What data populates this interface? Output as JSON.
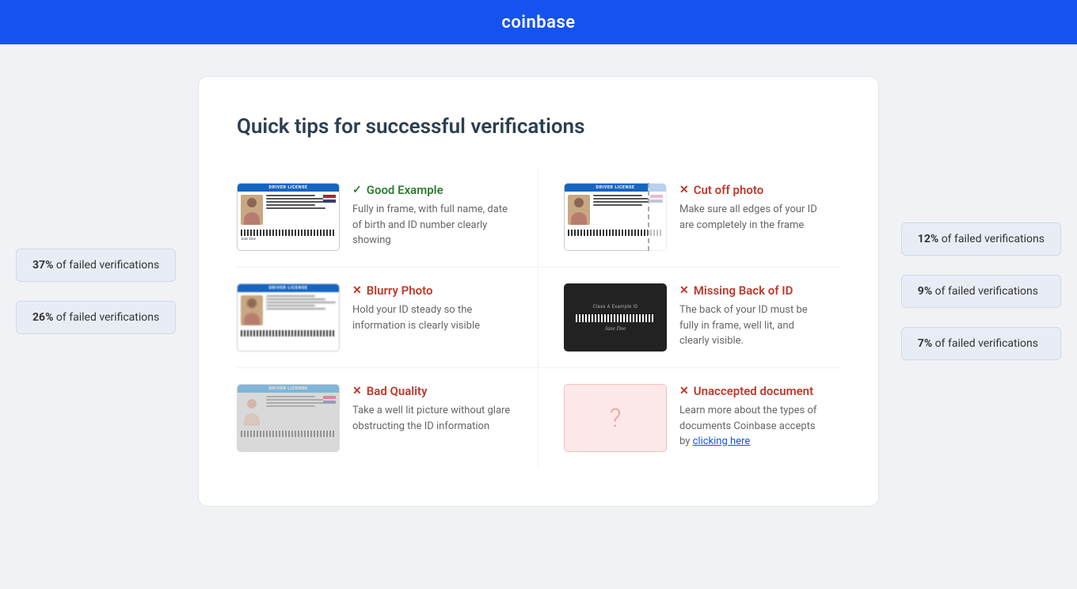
{
  "header": {
    "logo": "coinbase"
  },
  "page": {
    "title": "Quick tips for successful verifications"
  },
  "left_badges": [
    {
      "percent": "37%",
      "label": "of failed verifications"
    },
    {
      "percent": "26%",
      "label": "of failed verifications"
    }
  ],
  "right_badges": [
    {
      "percent": "12%",
      "label": "of failed verifications"
    },
    {
      "percent": "9%",
      "label": "of failed verifications"
    },
    {
      "percent": "7%",
      "label": "of failed verifications"
    }
  ],
  "tips": [
    {
      "id": "good-example",
      "status": "good",
      "icon": "✓",
      "label": "Good Example",
      "description": "Fully in frame, with full name, date of birth and ID number clearly showing",
      "card_type": "normal"
    },
    {
      "id": "cut-off-photo",
      "status": "bad",
      "icon": "✕",
      "label": "Cut off photo",
      "description": "Make sure all edges of your ID are completely in the frame",
      "card_type": "cutoff"
    },
    {
      "id": "blurry-photo",
      "status": "bad",
      "icon": "✕",
      "label": "Blurry Photo",
      "description": "Hold your ID steady so the information is clearly visible",
      "card_type": "blurry"
    },
    {
      "id": "missing-back",
      "status": "bad",
      "icon": "✕",
      "label": "Missing Back of ID",
      "description": "The back of your ID must be fully in frame, well lit, and clearly visible.",
      "card_type": "missing-back"
    },
    {
      "id": "bad-quality",
      "status": "bad",
      "icon": "✕",
      "label": "Bad Quality",
      "description": "Take a well lit picture without glare obstructing the ID information",
      "card_type": "badquality"
    },
    {
      "id": "unaccepted-document",
      "status": "bad",
      "icon": "✕",
      "label": "Unaccepted document",
      "description": "Learn more about the types of documents Coinbase accepts by ",
      "link_text": "clicking here",
      "card_type": "unaccepted"
    }
  ]
}
